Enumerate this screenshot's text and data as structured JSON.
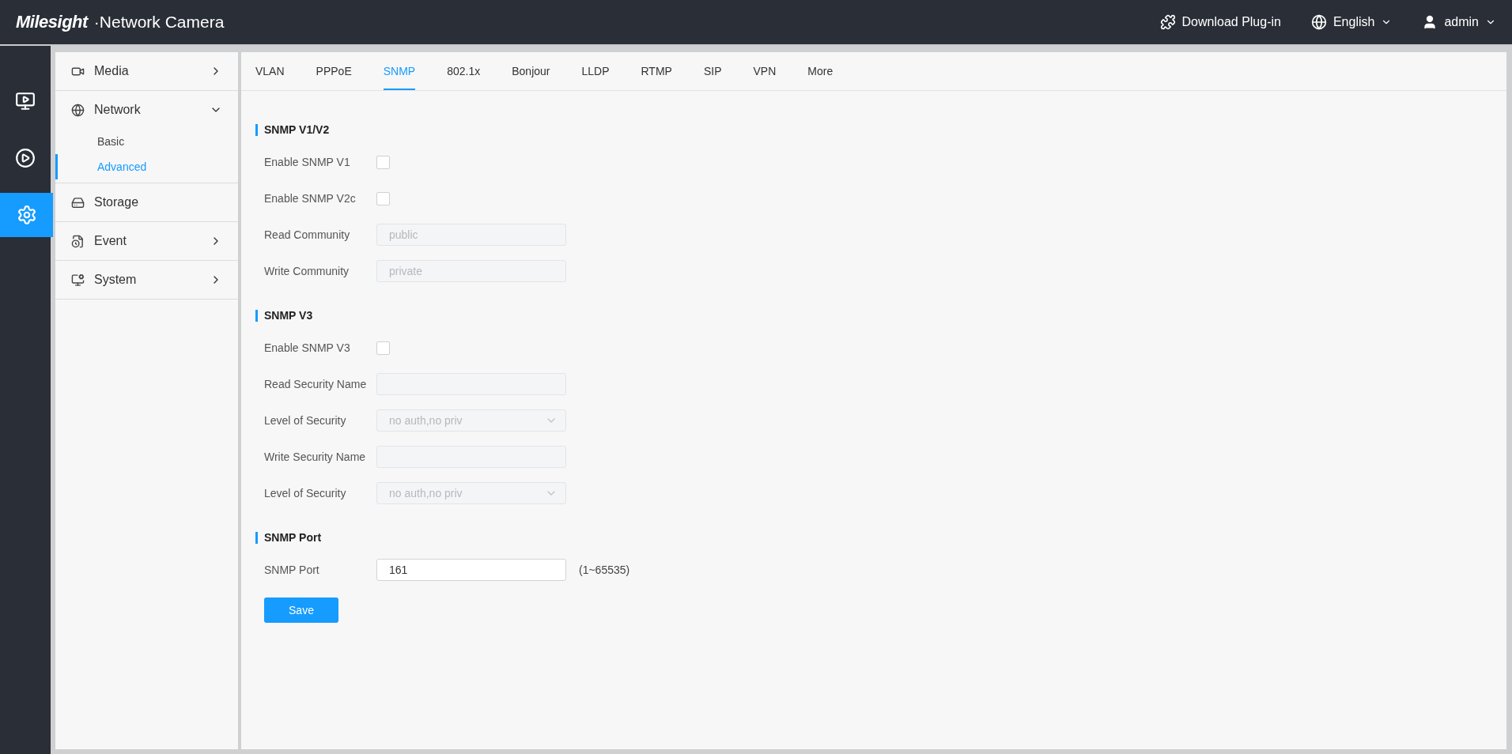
{
  "header": {
    "brand": "Milesight",
    "separator": "·",
    "product": "Network Camera",
    "actions": [
      {
        "kind": "plugin",
        "label": "Download Plug-in"
      },
      {
        "kind": "language",
        "label": "English"
      },
      {
        "kind": "user",
        "label": "admin"
      }
    ]
  },
  "rail": [
    {
      "kind": "live",
      "selected": false
    },
    {
      "kind": "playback",
      "selected": false
    },
    {
      "kind": "settings",
      "selected": true
    }
  ],
  "sidebar": {
    "items": [
      {
        "kind": "media",
        "label": "Media",
        "expanded": false
      },
      {
        "kind": "network",
        "label": "Network",
        "expanded": true,
        "children": [
          {
            "label": "Basic",
            "selected": false
          },
          {
            "label": "Advanced",
            "selected": true
          }
        ]
      },
      {
        "kind": "storage",
        "label": "Storage"
      },
      {
        "kind": "event",
        "label": "Event",
        "expanded": false
      },
      {
        "kind": "system",
        "label": "System",
        "expanded": false
      }
    ]
  },
  "tabs": [
    {
      "label": "VLAN",
      "selected": false
    },
    {
      "label": "PPPoE",
      "selected": false
    },
    {
      "label": "SNMP",
      "selected": true
    },
    {
      "label": "802.1x",
      "selected": false
    },
    {
      "label": "Bonjour",
      "selected": false
    },
    {
      "label": "LLDP",
      "selected": false
    },
    {
      "label": "RTMP",
      "selected": false
    },
    {
      "label": "SIP",
      "selected": false
    },
    {
      "label": "VPN",
      "selected": false
    },
    {
      "label": "More",
      "selected": false
    }
  ],
  "sections": [
    {
      "title": "SNMP V1/V2",
      "rows": [
        {
          "kind": "checkbox",
          "label": "Enable SNMP V1",
          "checked": false
        },
        {
          "kind": "checkbox",
          "label": "Enable SNMP V2c",
          "checked": false
        },
        {
          "kind": "input",
          "label": "Read Community",
          "placeholder": "public",
          "disabled": true
        },
        {
          "kind": "input",
          "label": "Write Community",
          "placeholder": "private",
          "disabled": true
        }
      ]
    },
    {
      "title": "SNMP V3",
      "rows": [
        {
          "kind": "checkbox",
          "label": "Enable SNMP V3",
          "checked": false
        },
        {
          "kind": "input",
          "label": "Read Security Name",
          "disabled": true
        },
        {
          "kind": "select",
          "label": "Level of Security",
          "value": "no auth,no priv",
          "disabled": true
        },
        {
          "kind": "input",
          "label": "Write Security Name",
          "disabled": true
        },
        {
          "kind": "select",
          "label": "Level of Security",
          "value": "no auth,no priv",
          "disabled": true
        }
      ]
    },
    {
      "title": "SNMP Port",
      "rows": [
        {
          "kind": "input",
          "label": "SNMP Port",
          "value": "161",
          "hint": "(1~65535)",
          "disabled": false
        }
      ]
    }
  ],
  "save": {
    "label": "Save"
  }
}
